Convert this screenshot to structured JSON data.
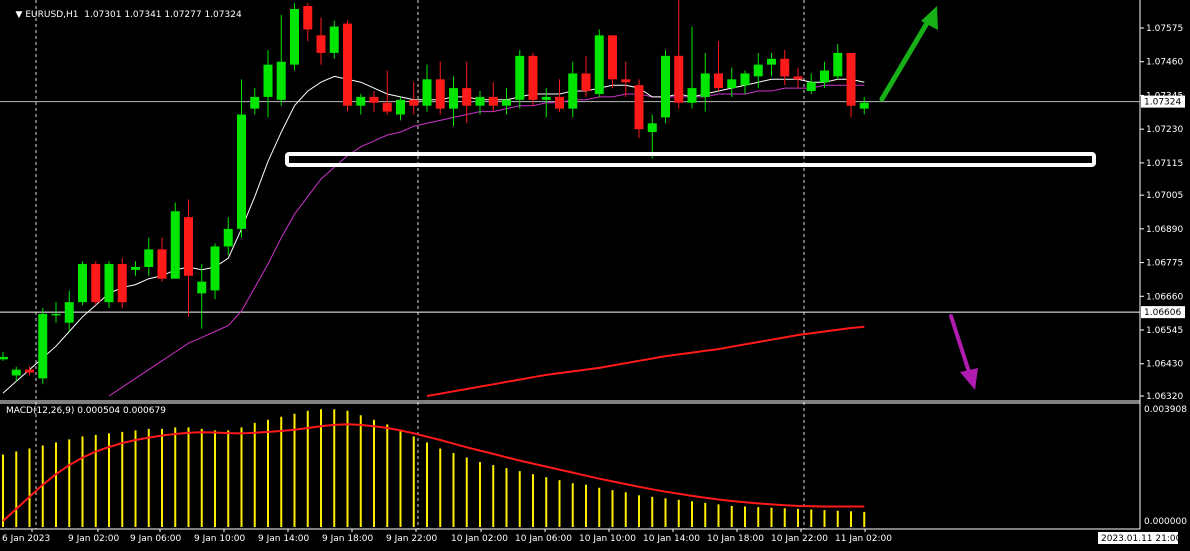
{
  "header": {
    "symbol_tf": "EURUSD,H1",
    "ohlc": "1.07301 1.07341 1.07277 1.07324"
  },
  "macd_label": "MACD(12,26,9) 0.000504 0.000679",
  "price_axis": [
    "1.07575",
    "1.07460",
    "1.07345",
    "1.07230",
    "1.07115",
    "1.07005",
    "1.06890",
    "1.06775",
    "1.06660",
    "1.06545",
    "1.06430",
    "1.06320"
  ],
  "price_badges": {
    "bid": "1.07324",
    "hline": "1.06606"
  },
  "macd_axis": {
    "top": "0.003908",
    "bottom": "0.000000"
  },
  "time_axis": [
    "6 Jan 2023",
    "9 Jan 02:00",
    "9 Jan 06:00",
    "9 Jan 10:00",
    "9 Jan 14:00",
    "9 Jan 18:00",
    "9 Jan 22:00",
    "10 Jan 02:00",
    "10 Jan 06:00",
    "10 Jan 10:00",
    "10 Jan 14:00",
    "10 Jan 18:00",
    "10 Jan 22:00",
    "11 Jan 02:00"
  ],
  "cursor_time": "2023.01.11 21:00",
  "colors": {
    "background": "#000000",
    "bull": "#00e600",
    "bear": "#ff1a1a",
    "ma_fast": "#ffffff",
    "ma_slow": "#cc33cc",
    "ma_long": "#ff1a1a",
    "macd_hist": "#ffee00",
    "macd_signal": "#ff1a1a",
    "arrow_up": "#17b017",
    "arrow_down": "#b01cb0",
    "grid": "#ffffff"
  },
  "icons": {
    "menu": "triangle-down-icon",
    "arrow_up": "arrow-up-icon",
    "arrow_down": "arrow-down-icon"
  },
  "chart_data": {
    "type": "candlestick",
    "symbol": "EURUSD",
    "timeframe": "H1",
    "ylim": [
      1.0632,
      1.0769
    ],
    "hline": 1.06606,
    "support_level": 1.07125,
    "candles": [
      {
        "o": 1.0645,
        "h": 1.0647,
        "l": 1.0644,
        "c": 1.0645
      },
      {
        "o": 1.0639,
        "h": 1.0642,
        "l": 1.0637,
        "c": 1.0641
      },
      {
        "o": 1.0641,
        "h": 1.0642,
        "l": 1.0639,
        "c": 1.064
      },
      {
        "o": 1.0638,
        "h": 1.0662,
        "l": 1.0636,
        "c": 1.066
      },
      {
        "o": 1.066,
        "h": 1.0664,
        "l": 1.0657,
        "c": 1.066
      },
      {
        "o": 1.0657,
        "h": 1.0668,
        "l": 1.0654,
        "c": 1.0664
      },
      {
        "o": 1.0664,
        "h": 1.0678,
        "l": 1.0663,
        "c": 1.0677
      },
      {
        "o": 1.0677,
        "h": 1.0678,
        "l": 1.0663,
        "c": 1.0664
      },
      {
        "o": 1.0664,
        "h": 1.0678,
        "l": 1.0662,
        "c": 1.0677
      },
      {
        "o": 1.0677,
        "h": 1.0679,
        "l": 1.0662,
        "c": 1.0664
      },
      {
        "o": 1.0675,
        "h": 1.0678,
        "l": 1.0673,
        "c": 1.0676
      },
      {
        "o": 1.0676,
        "h": 1.0686,
        "l": 1.0673,
        "c": 1.0682
      },
      {
        "o": 1.0682,
        "h": 1.0686,
        "l": 1.0671,
        "c": 1.0672
      },
      {
        "o": 1.0672,
        "h": 1.0698,
        "l": 1.0672,
        "c": 1.0695
      },
      {
        "o": 1.0693,
        "h": 1.0699,
        "l": 1.0659,
        "c": 1.0673
      },
      {
        "o": 1.0667,
        "h": 1.0677,
        "l": 1.0655,
        "c": 1.0671
      },
      {
        "o": 1.0668,
        "h": 1.0684,
        "l": 1.0665,
        "c": 1.0683
      },
      {
        "o": 1.0683,
        "h": 1.0693,
        "l": 1.068,
        "c": 1.0689
      },
      {
        "o": 1.0689,
        "h": 1.074,
        "l": 1.0686,
        "c": 1.0728
      },
      {
        "o": 1.073,
        "h": 1.0737,
        "l": 1.0728,
        "c": 1.0734
      },
      {
        "o": 1.0734,
        "h": 1.075,
        "l": 1.0727,
        "c": 1.0745
      },
      {
        "o": 1.0733,
        "h": 1.0762,
        "l": 1.0731,
        "c": 1.0746
      },
      {
        "o": 1.0745,
        "h": 1.0766,
        "l": 1.0743,
        "c": 1.0764
      },
      {
        "o": 1.0765,
        "h": 1.0766,
        "l": 1.0753,
        "c": 1.0757
      },
      {
        "o": 1.0755,
        "h": 1.0761,
        "l": 1.0745,
        "c": 1.0749
      },
      {
        "o": 1.0749,
        "h": 1.076,
        "l": 1.0747,
        "c": 1.0758
      },
      {
        "o": 1.0759,
        "h": 1.076,
        "l": 1.0729,
        "c": 1.0731
      },
      {
        "o": 1.0731,
        "h": 1.0735,
        "l": 1.0728,
        "c": 1.0734
      },
      {
        "o": 1.0734,
        "h": 1.0736,
        "l": 1.0729,
        "c": 1.0732
      },
      {
        "o": 1.0732,
        "h": 1.0743,
        "l": 1.0728,
        "c": 1.0729
      },
      {
        "o": 1.0728,
        "h": 1.0734,
        "l": 1.0726,
        "c": 1.0733
      },
      {
        "o": 1.0733,
        "h": 1.0739,
        "l": 1.0728,
        "c": 1.0731
      },
      {
        "o": 1.0731,
        "h": 1.0745,
        "l": 1.0729,
        "c": 1.074
      },
      {
        "o": 1.074,
        "h": 1.0746,
        "l": 1.0728,
        "c": 1.073
      },
      {
        "o": 1.073,
        "h": 1.0741,
        "l": 1.0724,
        "c": 1.0737
      },
      {
        "o": 1.0737,
        "h": 1.0746,
        "l": 1.0725,
        "c": 1.0731
      },
      {
        "o": 1.0731,
        "h": 1.0736,
        "l": 1.0728,
        "c": 1.0734
      },
      {
        "o": 1.0734,
        "h": 1.0739,
        "l": 1.0729,
        "c": 1.0731
      },
      {
        "o": 1.0731,
        "h": 1.0737,
        "l": 1.0728,
        "c": 1.0733
      },
      {
        "o": 1.0733,
        "h": 1.075,
        "l": 1.073,
        "c": 1.0748
      },
      {
        "o": 1.0748,
        "h": 1.0749,
        "l": 1.0731,
        "c": 1.0733
      },
      {
        "o": 1.0733,
        "h": 1.0737,
        "l": 1.0727,
        "c": 1.0734
      },
      {
        "o": 1.0734,
        "h": 1.074,
        "l": 1.0729,
        "c": 1.073
      },
      {
        "o": 1.073,
        "h": 1.0746,
        "l": 1.0727,
        "c": 1.0742
      },
      {
        "o": 1.0742,
        "h": 1.0748,
        "l": 1.0734,
        "c": 1.0736
      },
      {
        "o": 1.0735,
        "h": 1.0757,
        "l": 1.0734,
        "c": 1.0755
      },
      {
        "o": 1.0755,
        "h": 1.0755,
        "l": 1.0737,
        "c": 1.074
      },
      {
        "o": 1.074,
        "h": 1.0746,
        "l": 1.0734,
        "c": 1.0739
      },
      {
        "o": 1.0738,
        "h": 1.074,
        "l": 1.072,
        "c": 1.0723
      },
      {
        "o": 1.0722,
        "h": 1.0728,
        "l": 1.0713,
        "c": 1.0725
      },
      {
        "o": 1.0727,
        "h": 1.075,
        "l": 1.0725,
        "c": 1.0748
      },
      {
        "o": 1.0748,
        "h": 1.0768,
        "l": 1.073,
        "c": 1.0732
      },
      {
        "o": 1.0732,
        "h": 1.0758,
        "l": 1.073,
        "c": 1.0737
      },
      {
        "o": 1.0734,
        "h": 1.0749,
        "l": 1.0729,
        "c": 1.0742
      },
      {
        "o": 1.0742,
        "h": 1.0753,
        "l": 1.0736,
        "c": 1.0737
      },
      {
        "o": 1.0737,
        "h": 1.0744,
        "l": 1.0734,
        "c": 1.074
      },
      {
        "o": 1.0738,
        "h": 1.0743,
        "l": 1.0735,
        "c": 1.0742
      },
      {
        "o": 1.0741,
        "h": 1.0749,
        "l": 1.0737,
        "c": 1.0745
      },
      {
        "o": 1.0745,
        "h": 1.0749,
        "l": 1.0741,
        "c": 1.0747
      },
      {
        "o": 1.0747,
        "h": 1.075,
        "l": 1.0738,
        "c": 1.0741
      },
      {
        "o": 1.0741,
        "h": 1.0744,
        "l": 1.0737,
        "c": 1.074
      },
      {
        "o": 1.0736,
        "h": 1.0742,
        "l": 1.0735,
        "c": 1.0739
      },
      {
        "o": 1.0739,
        "h": 1.0746,
        "l": 1.0737,
        "c": 1.0743
      },
      {
        "o": 1.0741,
        "h": 1.0752,
        "l": 1.074,
        "c": 1.0749
      },
      {
        "o": 1.0749,
        "h": 1.0749,
        "l": 1.0727,
        "c": 1.0731
      },
      {
        "o": 1.073,
        "h": 1.0734,
        "l": 1.0728,
        "c": 1.0732
      }
    ],
    "ma_fast": [
      1.0633,
      1.0637,
      1.0641,
      1.0645,
      1.0649,
      1.0654,
      1.0659,
      1.0663,
      1.0667,
      1.0669,
      1.067,
      1.0672,
      1.0673,
      1.0675,
      1.0676,
      1.0675,
      1.0676,
      1.0679,
      1.0689,
      1.07,
      1.0712,
      1.0722,
      1.0731,
      1.0736,
      1.0739,
      1.0741,
      1.074,
      1.0739,
      1.0737,
      1.0735,
      1.0734,
      1.0733,
      1.0733,
      1.0733,
      1.0734,
      1.0734,
      1.0733,
      1.0733,
      1.0733,
      1.0734,
      1.0735,
      1.0735,
      1.0735,
      1.0736,
      1.0736,
      1.0737,
      1.0738,
      1.0738,
      1.0737,
      1.0734,
      1.0734,
      1.0735,
      1.0734,
      1.0735,
      1.0736,
      1.0737,
      1.0738,
      1.0739,
      1.074,
      1.074,
      1.074,
      1.0739,
      1.0739,
      1.074,
      1.074,
      1.0739
    ],
    "ma_slow": [
      null,
      null,
      null,
      null,
      null,
      null,
      null,
      null,
      1.0632,
      1.0635,
      1.0638,
      1.0641,
      1.0644,
      1.0647,
      1.065,
      1.0652,
      1.0654,
      1.0656,
      1.0661,
      1.0669,
      1.0677,
      1.0686,
      1.0694,
      1.07,
      1.0706,
      1.071,
      1.0714,
      1.0717,
      1.0719,
      1.0721,
      1.0722,
      1.0724,
      1.0725,
      1.0726,
      1.0727,
      1.0728,
      1.0729,
      1.0729,
      1.073,
      1.0731,
      1.0731,
      1.0732,
      1.0732,
      1.0733,
      1.0733,
      1.0734,
      1.0734,
      1.0735,
      1.0735,
      1.0734,
      1.0734,
      1.0734,
      1.0734,
      1.0734,
      1.0735,
      1.0735,
      1.0735,
      1.0736,
      1.0736,
      1.0737,
      1.0737,
      1.0737,
      1.0738,
      1.0738,
      1.0738,
      1.0738
    ],
    "ma_long": [
      null,
      null,
      null,
      null,
      null,
      null,
      null,
      null,
      null,
      null,
      null,
      null,
      null,
      null,
      null,
      null,
      null,
      null,
      null,
      null,
      null,
      null,
      null,
      null,
      null,
      null,
      null,
      null,
      null,
      null,
      null,
      null,
      1.0632,
      1.06328,
      1.06336,
      1.06344,
      1.06352,
      1.0636,
      1.06368,
      1.06376,
      1.06384,
      1.06392,
      1.06398,
      1.06404,
      1.0641,
      1.06416,
      1.06424,
      1.06432,
      1.0644,
      1.06448,
      1.06456,
      1.06462,
      1.06468,
      1.06474,
      1.0648,
      1.06488,
      1.06496,
      1.06504,
      1.06512,
      1.0652,
      1.06528,
      1.06534,
      1.0654,
      1.06546,
      1.06552,
      1.06556
    ],
    "macd_ylim": [
      0.0,
      0.003908
    ],
    "macd_hist": [
      0.0024,
      0.0025,
      0.0026,
      0.0027,
      0.0028,
      0.0029,
      0.003,
      0.00305,
      0.0031,
      0.00315,
      0.0032,
      0.00325,
      0.00325,
      0.0033,
      0.0033,
      0.00325,
      0.0032,
      0.0032,
      0.0033,
      0.00345,
      0.00355,
      0.00365,
      0.00375,
      0.00385,
      0.0039,
      0.0039,
      0.00385,
      0.0037,
      0.00355,
      0.0034,
      0.0032,
      0.003,
      0.0028,
      0.0026,
      0.00245,
      0.0023,
      0.00215,
      0.00205,
      0.00195,
      0.00185,
      0.00175,
      0.00165,
      0.00155,
      0.00145,
      0.0014,
      0.0013,
      0.00122,
      0.00115,
      0.00105,
      0.001,
      0.00095,
      0.0009,
      0.00085,
      0.0008,
      0.00075,
      0.0007,
      0.00068,
      0.00066,
      0.00064,
      0.00062,
      0.0006,
      0.00058,
      0.00056,
      0.00054,
      0.00052,
      0.0005
    ],
    "macd_signal": [
      0.0002,
      0.0006,
      0.001,
      0.0014,
      0.00175,
      0.00205,
      0.0023,
      0.0025,
      0.00265,
      0.00278,
      0.00288,
      0.00296,
      0.00303,
      0.00308,
      0.00312,
      0.00314,
      0.00313,
      0.00311,
      0.0031,
      0.00312,
      0.00315,
      0.00318,
      0.00322,
      0.00328,
      0.00334,
      0.00338,
      0.0034,
      0.00338,
      0.00334,
      0.00328,
      0.0032,
      0.0031,
      0.00299,
      0.00288,
      0.00276,
      0.00264,
      0.00253,
      0.00242,
      0.00231,
      0.0022,
      0.0021,
      0.002,
      0.0019,
      0.0018,
      0.0017,
      0.0016,
      0.00151,
      0.00142,
      0.00133,
      0.00125,
      0.00117,
      0.0011,
      0.00103,
      0.00097,
      0.00091,
      0.00086,
      0.00082,
      0.00078,
      0.00075,
      0.00072,
      0.0007,
      0.00069,
      0.00068,
      0.00068,
      0.00068,
      0.00068
    ]
  }
}
